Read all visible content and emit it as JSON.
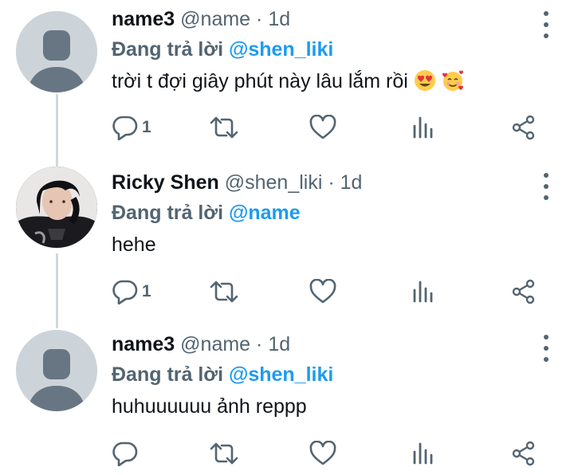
{
  "tweets": [
    {
      "name": "name3",
      "handle": "@name",
      "separator": "·",
      "time": "1d",
      "replying_prefix": "Đang trả lời",
      "replying_to": "@shen_liki",
      "text": "trời t đợi giây phút này lâu lắm rồi",
      "emojis": [
        "smiling-face-heart-eyes",
        "smiling-face-with-hearts"
      ],
      "reply_count": "1",
      "avatar": "default-avatar"
    },
    {
      "name": "Ricky Shen",
      "handle": "@shen_liki",
      "separator": "·",
      "time": "1d",
      "replying_prefix": "Đang trả lời",
      "replying_to": "@name",
      "text": "hehe",
      "reply_count": "1",
      "avatar": "profile-photo"
    },
    {
      "name": "name3",
      "handle": "@name",
      "separator": "·",
      "time": "1d",
      "replying_prefix": "Đang trả lời",
      "replying_to": "@shen_liki",
      "text": "huhuuuuuu ảnh reppp",
      "reply_count": "",
      "avatar": "default-avatar"
    }
  ],
  "icons": {
    "reply": "speech-bubble-icon",
    "retweet": "retweet-icon",
    "like": "heart-icon",
    "analytics": "bar-chart-icon",
    "share": "share-icon",
    "more": "vertical-dots-icon"
  },
  "colors": {
    "link": "#1d9bf0",
    "secondary_text": "#536471",
    "primary_text": "#0f1419",
    "thread_line": "#cfd9de",
    "avatar_bg": "#cdd4d9",
    "avatar_fg": "#687684"
  }
}
